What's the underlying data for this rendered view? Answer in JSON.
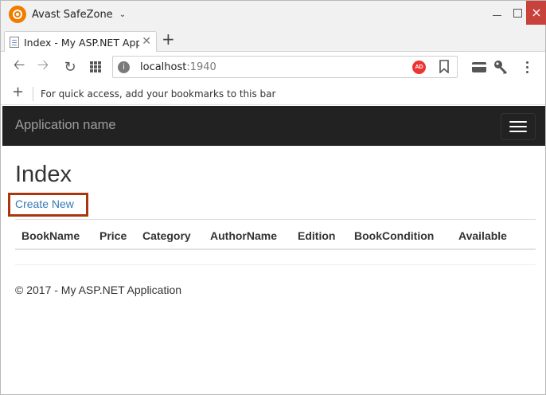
{
  "browser": {
    "profile_name": "Avast SafeZone",
    "window_controls": {
      "minimize": "minimize",
      "maximize": "maximize",
      "close": "×"
    },
    "tab": {
      "title": "Index - My ASP.NET Applic",
      "close": "✕"
    },
    "new_tab": "+",
    "address": {
      "host": "localhost",
      "port": ":1940",
      "adblock_badge": "AD"
    },
    "bookmarks_bar": {
      "add": "+",
      "hint": "For quick access, add your bookmarks to this bar"
    },
    "icons": {
      "back": "arrow-left-icon",
      "forward": "arrow-right-icon",
      "reload": "reload-icon",
      "apps": "apps-grid-icon",
      "site_info": "site-info-icon",
      "bookmark": "bookmark-star-icon",
      "wallet": "card-icon",
      "key": "key-icon",
      "menu": "kebab-menu-icon"
    }
  },
  "page": {
    "navbar": {
      "brand": "Application name"
    },
    "title": "Index",
    "create_link": "Create New",
    "table": {
      "headers": [
        "BookName",
        "Price",
        "Category",
        "AuthorName",
        "Edition",
        "BookCondition",
        "Available"
      ]
    },
    "footer": "© 2017 - My ASP.NET Application"
  },
  "colors": {
    "navbar_bg": "#222222",
    "link": "#337ab7",
    "highlight_border": "#a8360e",
    "close_button": "#c8413b",
    "avast_orange": "#f07d00"
  }
}
